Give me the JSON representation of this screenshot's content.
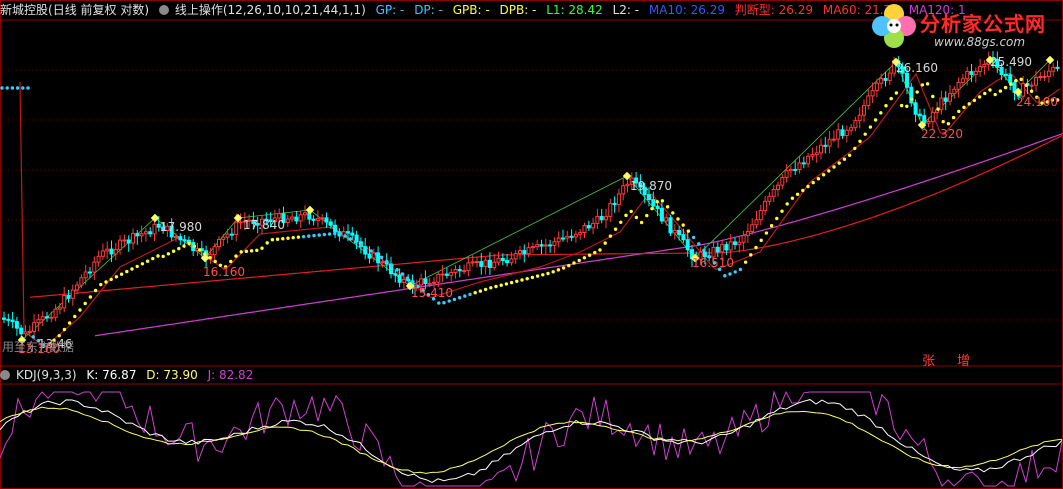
{
  "header": {
    "stock_name": "新城控股",
    "mode": "(日线 前复权 对数)",
    "indicator": "线上操作(12,26,10,10,21,44,1,1)",
    "gp": "GP: -",
    "dp": "DP: -",
    "gpb": "GPB: -",
    "dpb": "DPB: -",
    "l1": "L1: 28.42",
    "l2": "L2: -",
    "ma10": "MA10: 26.29",
    "judge": "判断型: 26.29",
    "ma60": "MA60: 21.75",
    "ma120": "MA120: 1"
  },
  "logo": {
    "title": "分析家公式网",
    "url": "www.88gs.com"
  },
  "kdj": {
    "label": "KDJ(9,3,3)",
    "k": "K: 76.87",
    "d": "D: 73.90",
    "j": "J: 82.82"
  },
  "bottom_labels": {
    "rise": "张",
    "increase": "增"
  },
  "annotations": {
    "p1": "17.980",
    "p2": "17.840",
    "p3": "16.160",
    "p4": "15.410",
    "p5": "19.870",
    "p6": "16.510",
    "p7": "26.160",
    "p8": "22.320",
    "p9": "25.490",
    "p10": "24.100",
    "p11": "13.46",
    "p12": "13.160",
    "pan_note": "用至东方数据"
  },
  "colors": {
    "up": "#ff3a3a",
    "down": "#00ffff",
    "ma_red": "#e02020",
    "ma_magenta": "#d040d0",
    "dots_yellow": "#ffff33",
    "dots_cyan": "#33d0ff",
    "k_line": "#ffffff",
    "d_line": "#ffff66",
    "j_line": "#d040d0"
  }
}
